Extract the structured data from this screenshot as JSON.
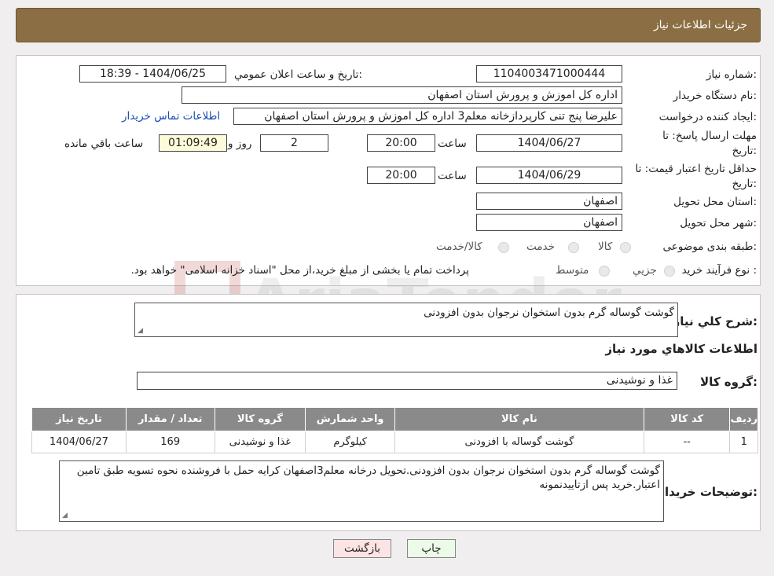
{
  "header": {
    "title": "جزئیات اطلاعات نیاز"
  },
  "watermark": {
    "text": "AriaTender.neT"
  },
  "form": {
    "need_number": {
      "label": "شماره نیاز:",
      "value": "1104003471000444"
    },
    "announce_datetime": {
      "label": "تاریخ و ساعت اعلان عمومي:",
      "value": "1404/06/25 - 18:39"
    },
    "buyer_org": {
      "label": "نام دستگاه خریدار:",
      "value": "اداره کل اموزش و پرورش استان اصفهان"
    },
    "requester": {
      "label": "ایجاد کننده درخواست:",
      "value": "علیرضا پنج تنی کارپردازخانه معلم3 اداره کل اموزش و پرورش استان اصفهان",
      "contact_link": "اطلاعات تماس خریدار"
    },
    "reply_deadline": {
      "label_line1": "مهلت ارسال پاسخ: تا",
      "label_line2": "تاریخ:",
      "date": "1404/06/27",
      "time_label": "ساعت",
      "time": "20:00",
      "days": "2",
      "days_label": "روز و",
      "remaining": "01:09:49",
      "remaining_label": "ساعت باقي مانده"
    },
    "price_validity": {
      "label_line1": "حداقل تاریخ اعتبار قیمت: تا",
      "label_line2": "تاریخ:",
      "date": "1404/06/29",
      "time_label": "ساعت",
      "time": "20:00"
    },
    "delivery_province": {
      "label": "استان محل تحویل:",
      "value": "اصفهان"
    },
    "delivery_city": {
      "label": "شهر محل تحویل:",
      "value": "اصفهان"
    },
    "category": {
      "label": "طبقه بندی موضوعی:",
      "options": [
        "کالا",
        "خدمت",
        "کالا/خدمت"
      ]
    },
    "purchase_type": {
      "label": "نوع فرآیند خرید :",
      "options": [
        "جزیي",
        "متوسط"
      ],
      "note": "پرداخت تمام یا بخشی از مبلغ خرید،از محل \"اسناد خزانه اسلامی\" خواهد بود."
    }
  },
  "details": {
    "summary_label": "شرح كلي نياز:",
    "summary_value": "گوشت گوساله گرم بدون استخوان نرجوان بدون افزودنی",
    "items_heading": "اطلاعات كالاهاي مورد نياز",
    "group_label": "گروه کالا:",
    "group_value": "غذا و نوشیدنی",
    "table": {
      "headers": [
        "ردیف",
        "کد کالا",
        "نام کالا",
        "واحد شمارش",
        "گروه کالا",
        "تعداد / مقدار",
        "تاریخ نیاز"
      ],
      "rows": [
        [
          "1",
          "--",
          "گوشت گوساله با افزودنی",
          "کیلوگرم",
          "غذا و نوشیدنی",
          "169",
          "1404/06/27"
        ]
      ]
    },
    "buyer_notes_label": "توضیحات خریدار:",
    "buyer_notes_value": "گوشت گوساله گرم بدون استخوان نرجوان بدون افزودنی.تحویل درخانه معلم3اصفهان کرایه حمل با فروشنده نحوه تسویه طبق تامین اعتبار.خرید پس ازتاییدنمونه"
  },
  "buttons": {
    "print": "چاپ",
    "back": "بازگشت"
  }
}
